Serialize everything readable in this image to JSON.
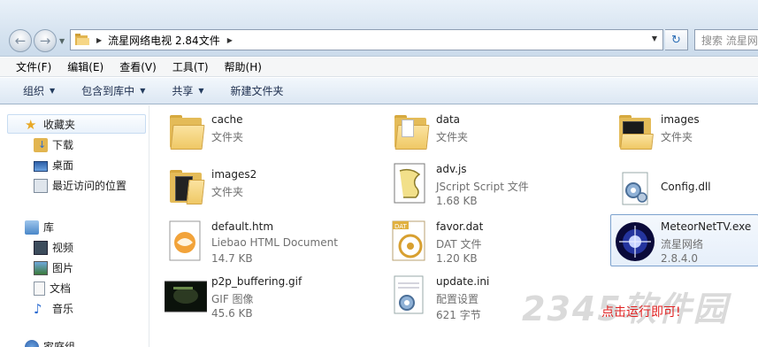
{
  "address": {
    "path": "流星网络电视 2.84文件",
    "search_placeholder": "搜索 流星网络..."
  },
  "menu": [
    "文件(F)",
    "编辑(E)",
    "查看(V)",
    "工具(T)",
    "帮助(H)"
  ],
  "commands": {
    "organize": "组织",
    "include_library": "包含到库中",
    "share": "共享",
    "new_folder": "新建文件夹"
  },
  "nav": {
    "favorites": "收藏夹",
    "downloads": "下载",
    "desktop": "桌面",
    "recent": "最近访问的位置",
    "libraries": "库",
    "videos": "视频",
    "pictures": "图片",
    "documents": "文档",
    "music": "音乐",
    "homegroup": "家庭组"
  },
  "files": {
    "cache": {
      "name": "cache",
      "type": "文件夹"
    },
    "data": {
      "name": "data",
      "type": "文件夹"
    },
    "images": {
      "name": "images",
      "type": "文件夹"
    },
    "images2": {
      "name": "images2",
      "type": "文件夹"
    },
    "advjs": {
      "name": "adv.js",
      "type": "JScript Script 文件",
      "size": "1.68 KB"
    },
    "config": {
      "name": "Config.dll"
    },
    "default": {
      "name": "default.htm",
      "type": "Liebao HTML Document",
      "size": "14.7 KB"
    },
    "favor": {
      "name": "favor.dat",
      "type": "DAT 文件",
      "size": "1.20 KB"
    },
    "meteor": {
      "name": "MeteorNetTV.exe",
      "type": "流星网络",
      "size": "2.8.4.0"
    },
    "p2p": {
      "name": "p2p_buffering.gif",
      "type": "GIF 图像",
      "size": "45.6 KB"
    },
    "update": {
      "name": "update.ini",
      "type": "配置设置",
      "size": "621 字节"
    }
  },
  "annotation": "点击运行即可!",
  "watermark": "2345软件园",
  "icon_names": [
    "back-icon",
    "forward-icon",
    "folder-icon",
    "refresh-icon",
    "star-icon",
    "download-icon",
    "desktop-icon",
    "recent-icon",
    "library-icon",
    "video-icon",
    "picture-icon",
    "document-icon",
    "music-icon",
    "homegroup-icon"
  ],
  "colors": {
    "selection": "#7da2ce",
    "annotation": "#e02020",
    "folder": "#e4bb58"
  }
}
